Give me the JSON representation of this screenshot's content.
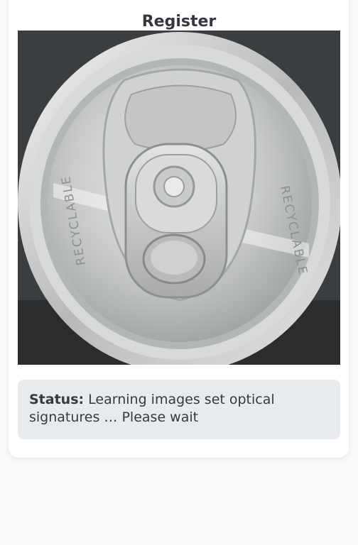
{
  "page": {
    "title": "Register"
  },
  "image": {
    "embossed_text": "RECYCLABLE"
  },
  "status": {
    "label": "Status:",
    "message": " Learning images set optical signatures … Please wait"
  }
}
